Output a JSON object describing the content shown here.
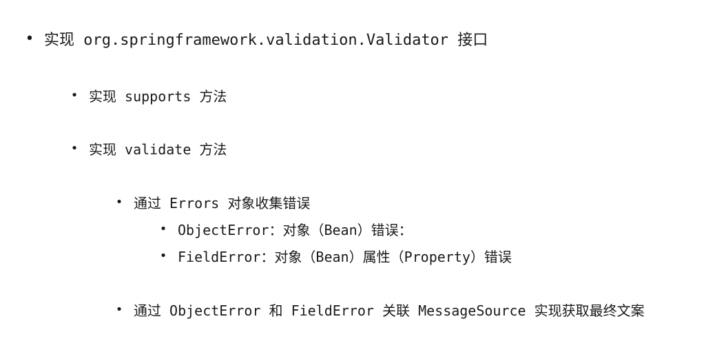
{
  "document": {
    "items": [
      {
        "level": 1,
        "text": "实现 org.springframework.validation.Validator 接口"
      },
      {
        "level": 2,
        "text": "实现 supports 方法"
      },
      {
        "level": 2,
        "text": "实现 validate 方法"
      },
      {
        "level": 3,
        "text": "通过 Errors 对象收集错误"
      },
      {
        "level": 4,
        "text": "ObjectError：对象（Bean）错误："
      },
      {
        "level": 4,
        "text": "FieldError：对象（Bean）属性（Property）错误"
      },
      {
        "level": 3,
        "text": "通过 ObjectError 和 FieldError 关联 MessageSource 实现获取最终文案"
      }
    ],
    "bullet": "•"
  }
}
